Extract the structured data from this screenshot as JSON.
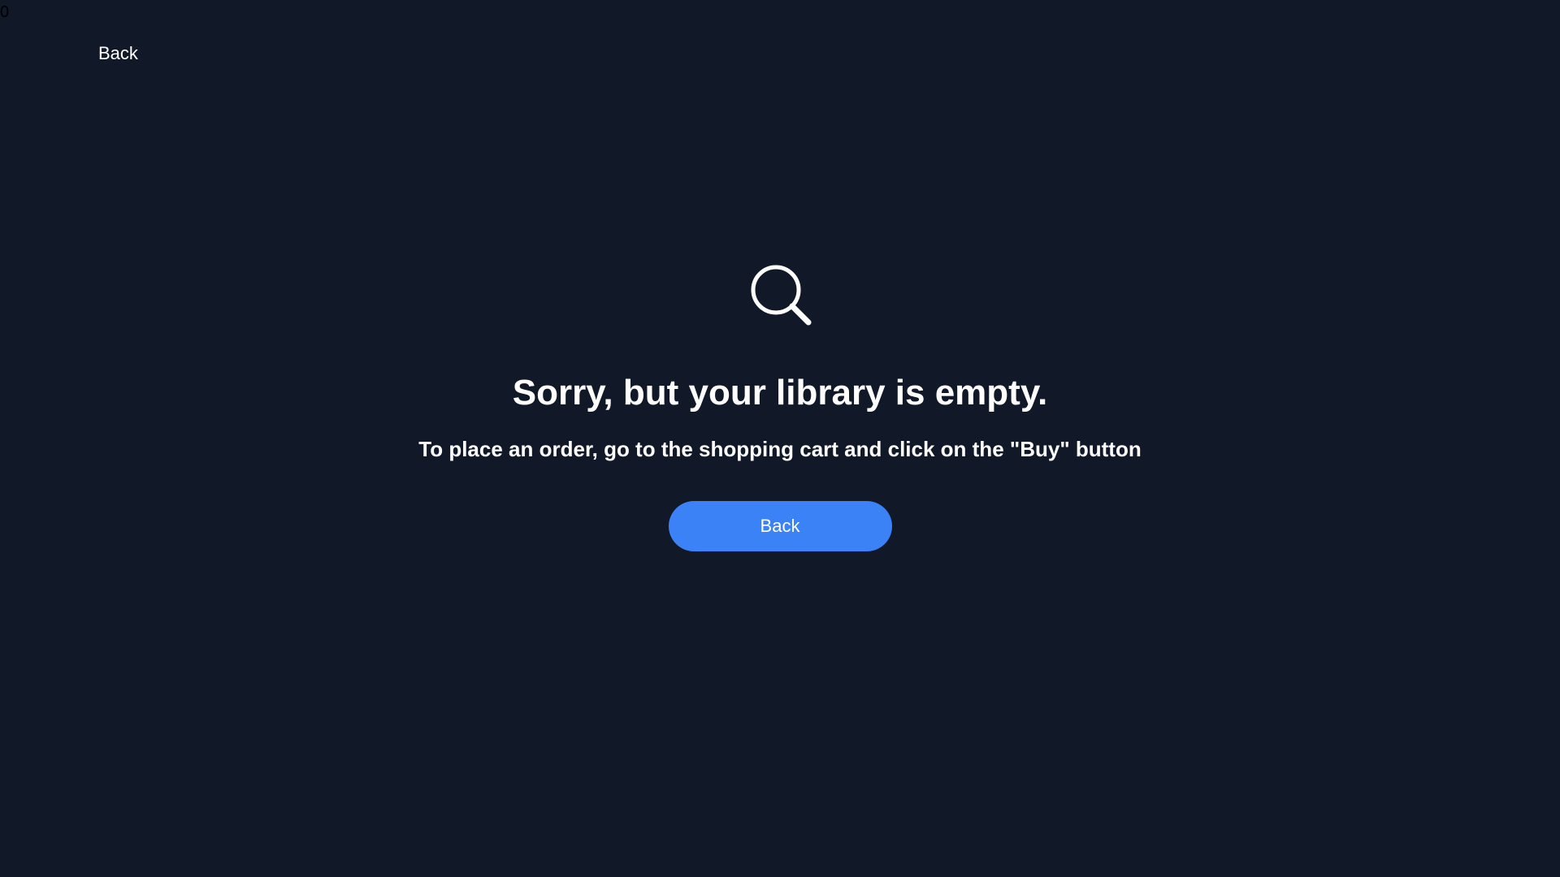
{
  "corner_counter": "0",
  "header": {
    "back_link_label": "Back"
  },
  "empty_state": {
    "icon": "search-icon",
    "title": "Sorry, but your library is empty.",
    "subtitle": "To place an order, go to the shopping cart and click on the \"Buy\" button",
    "button_label": "Back"
  },
  "colors": {
    "background": "#111827",
    "text": "#ffffff",
    "accent": "#3b82f6"
  }
}
